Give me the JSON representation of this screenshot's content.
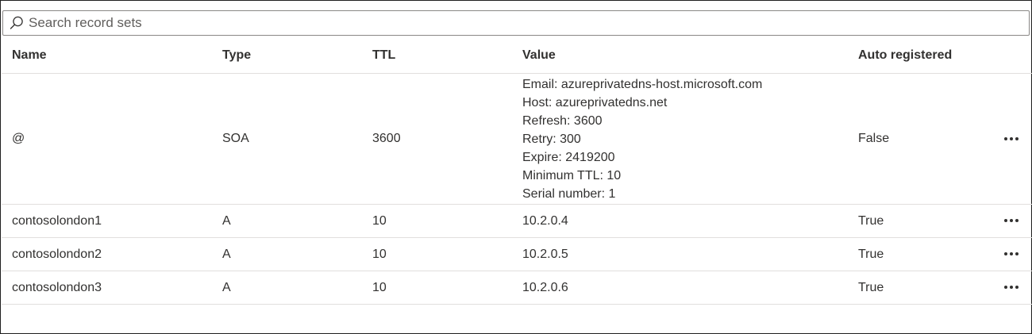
{
  "search": {
    "placeholder": "Search record sets",
    "value": ""
  },
  "table": {
    "columns": [
      "Name",
      "Type",
      "TTL",
      "Value",
      "Auto registered"
    ],
    "rows": [
      {
        "name": "@",
        "type": "SOA",
        "ttl": "3600",
        "value_lines": [
          "Email: azureprivatedns-host.microsoft.com",
          "Host: azureprivatedns.net",
          "Refresh: 3600",
          "Retry: 300",
          "Expire: 2419200",
          "Minimum TTL: 10",
          "Serial number: 1"
        ],
        "auto_registered": "False"
      },
      {
        "name": "contosolondon1",
        "type": "A",
        "ttl": "10",
        "value_lines": [
          "10.2.0.4"
        ],
        "auto_registered": "True"
      },
      {
        "name": "contosolondon2",
        "type": "A",
        "ttl": "10",
        "value_lines": [
          "10.2.0.5"
        ],
        "auto_registered": "True"
      },
      {
        "name": "contosolondon3",
        "type": "A",
        "ttl": "10",
        "value_lines": [
          "10.2.0.6"
        ],
        "auto_registered": "True"
      }
    ]
  },
  "icons": {
    "search": "search-icon",
    "more": "more-options-icon"
  },
  "colors": {
    "text": "#323130",
    "border": "#e1dfdd",
    "search_border": "#8a8886"
  }
}
